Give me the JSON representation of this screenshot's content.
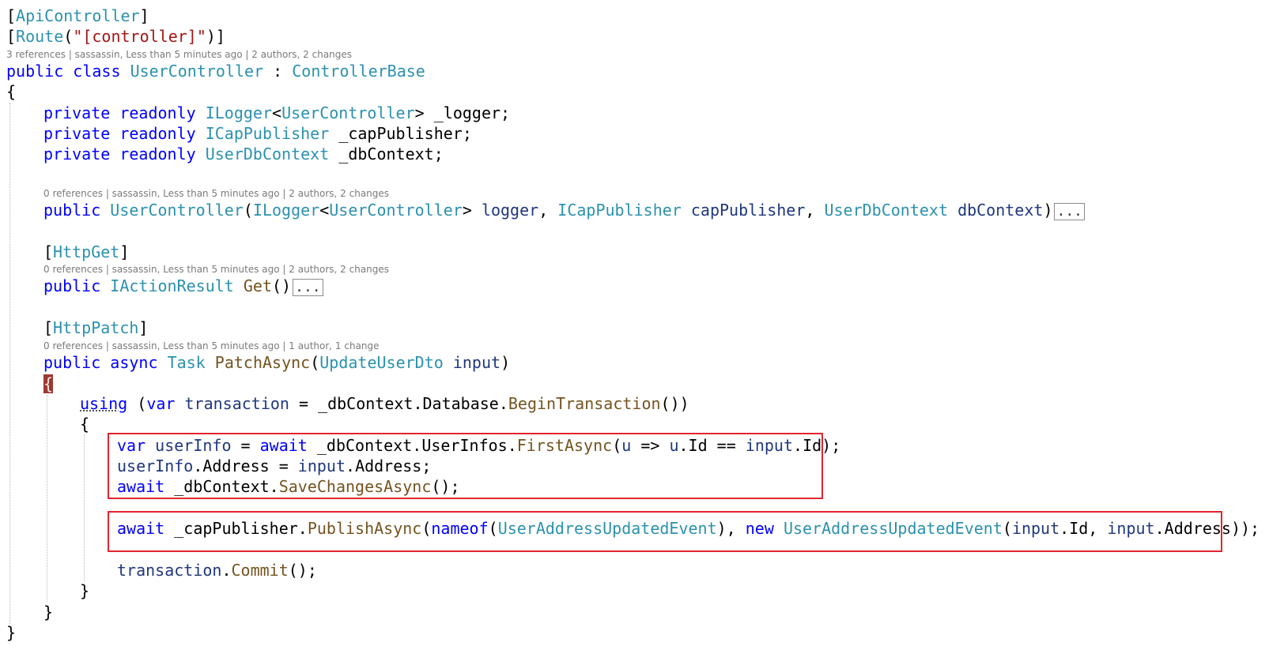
{
  "code": {
    "attr_api": "ApiController",
    "attr_route": "Route",
    "route_string": "\"[controller]\"",
    "kw_public": "public",
    "kw_class": "class",
    "class_name": "UserController",
    "base_class": "ControllerBase",
    "kw_private": "private",
    "kw_readonly": "readonly",
    "t_ilogger": "ILogger",
    "t_icap": "ICapPublisher",
    "t_dbctx": "UserDbContext",
    "f_logger": "_logger;",
    "f_cap": "_capPublisher;",
    "f_db": "_dbContext;",
    "p_logger": "logger",
    "p_cap": "capPublisher",
    "p_db": "dbContext",
    "fold_marker": "...",
    "attr_get": "HttpGet",
    "t_iaction": "IActionResult",
    "m_get": "Get",
    "attr_patch": "HttpPatch",
    "kw_async": "async",
    "t_task": "Task",
    "m_patch": "PatchAsync",
    "t_dto": "UpdateUserDto",
    "p_input": "input",
    "kw_using": "using",
    "kw_var": "var",
    "v_transaction": "transaction",
    "m_begin": "BeginTransaction",
    "v_userinfo": "userInfo",
    "kw_await": "await",
    "m_first": "FirstAsync",
    "m_save": "SaveChangesAsync",
    "m_publish": "PublishAsync",
    "kw_nameof": "nameof",
    "t_event": "UserAddressUpdatedEvent",
    "kw_new": "new",
    "m_commit": "Commit",
    "t_database": "Database",
    "t_userinfos": "UserInfos",
    "p_u": "u",
    "prop_id": "Id",
    "prop_address": "Address"
  },
  "codelens": {
    "class": "3 references | sassassin, Less than 5 minutes ago | 2 authors, 2 changes",
    "ctor": "0 references | sassassin, Less than 5 minutes ago | 2 authors, 2 changes",
    "get": "0 references | sassassin, Less than 5 minutes ago | 2 authors, 2 changes",
    "patch": "0 references | sassassin, Less than 5 minutes ago | 1 author, 1 change"
  },
  "highlight_color": "#e3252f"
}
